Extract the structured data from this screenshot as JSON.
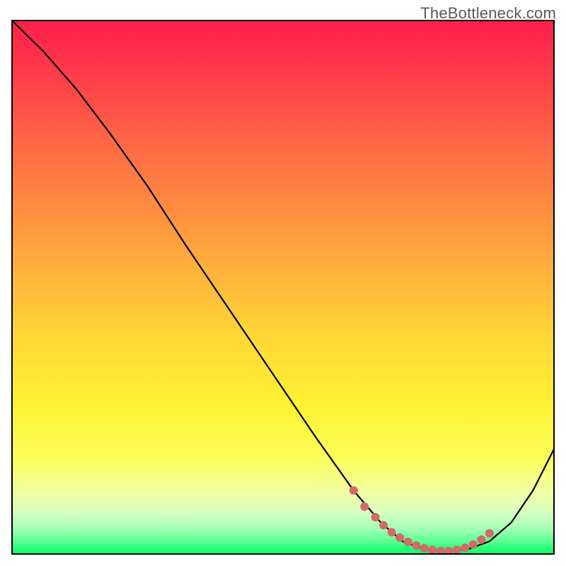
{
  "watermark": "TheBottleneck.com",
  "chart_data": {
    "type": "line",
    "title": "",
    "xlabel": "",
    "ylabel": "",
    "xlim": [
      0,
      100
    ],
    "ylim": [
      0,
      100
    ],
    "grid": false,
    "series": [
      {
        "name": "curve",
        "color": "#000000",
        "x": [
          0,
          6,
          12,
          18,
          25,
          32,
          40,
          48,
          56,
          63,
          68,
          72,
          76,
          80,
          84,
          88,
          92,
          96,
          100
        ],
        "values": [
          100,
          94,
          87,
          79,
          69,
          58,
          46,
          34,
          22,
          12,
          6,
          2.5,
          1.0,
          0.7,
          1.0,
          2.5,
          6,
          12,
          20
        ]
      },
      {
        "name": "markers",
        "color": "#d26a6a",
        "marker_size": 6,
        "x": [
          63.0,
          65.0,
          67.0,
          68.5,
          70.0,
          71.5,
          73.0,
          74.5,
          76.0,
          77.5,
          79.0,
          80.5,
          82.0,
          83.5,
          85.0,
          86.5,
          88.0
        ],
        "values": [
          12.0,
          9.0,
          7.0,
          5.5,
          4.2,
          3.2,
          2.4,
          1.7,
          1.2,
          0.9,
          0.7,
          0.7,
          0.9,
          1.3,
          1.9,
          2.8,
          4.0
        ]
      }
    ],
    "background_gradient_stops": [
      {
        "pos": 0.0,
        "color": "#ff1e4c"
      },
      {
        "pos": 0.1,
        "color": "#ff3b4a"
      },
      {
        "pos": 0.24,
        "color": "#ff6a45"
      },
      {
        "pos": 0.36,
        "color": "#ff8f40"
      },
      {
        "pos": 0.48,
        "color": "#ffb53b"
      },
      {
        "pos": 0.6,
        "color": "#ffd936"
      },
      {
        "pos": 0.72,
        "color": "#fff233"
      },
      {
        "pos": 0.82,
        "color": "#fbff5a"
      },
      {
        "pos": 0.88,
        "color": "#f2ffa0"
      },
      {
        "pos": 0.92,
        "color": "#d8ffc0"
      },
      {
        "pos": 0.95,
        "color": "#a8ffb8"
      },
      {
        "pos": 0.975,
        "color": "#5dff93"
      },
      {
        "pos": 0.99,
        "color": "#1dff74"
      },
      {
        "pos": 1.0,
        "color": "#0cff6a"
      }
    ]
  }
}
